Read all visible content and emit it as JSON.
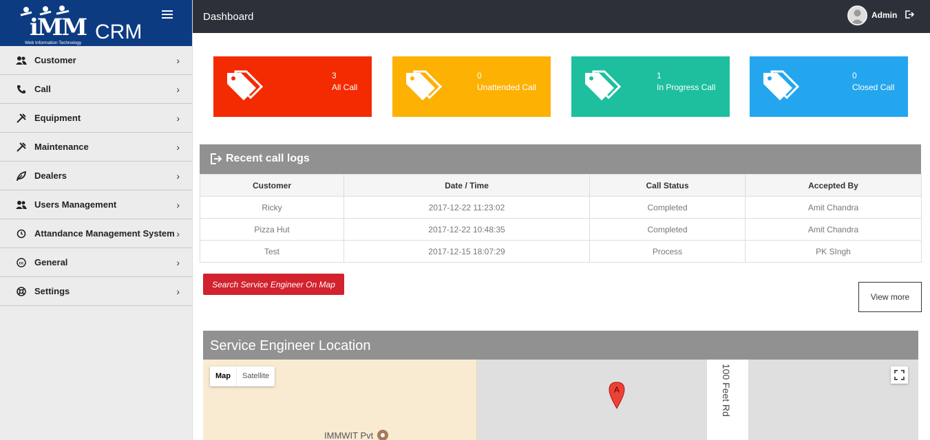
{
  "brand": {
    "logo_text": "iMM",
    "logo_sub": "Web Information Technology",
    "app_name": "CRM"
  },
  "sidebar": {
    "items": [
      {
        "label": "Customer",
        "icon": "users-icon"
      },
      {
        "label": "Call",
        "icon": "phone-icon"
      },
      {
        "label": "Equipment",
        "icon": "tools-icon"
      },
      {
        "label": "Maintenance",
        "icon": "tools-icon"
      },
      {
        "label": "Dealers",
        "icon": "leaf-icon"
      },
      {
        "label": "Users Management",
        "icon": "users-icon"
      },
      {
        "label": "Attandance Management System",
        "icon": "history-icon"
      },
      {
        "label": "General",
        "icon": "cc-icon"
      },
      {
        "label": "Settings",
        "icon": "lifebuoy-icon"
      }
    ],
    "chevron": "›"
  },
  "topbar": {
    "title": "Dashboard",
    "user": "Admin"
  },
  "cards": [
    {
      "count": "3",
      "label": "All Call",
      "color": "#f42a00"
    },
    {
      "count": "0",
      "label": "Unattended Call",
      "color": "#fdb103"
    },
    {
      "count": "1",
      "label": "In Progress Call",
      "color": "#1dbf9f"
    },
    {
      "count": "0",
      "label": "Closed Call",
      "color": "#24a6ee"
    }
  ],
  "recent_calls": {
    "title": "Recent call logs",
    "columns": [
      "Customer",
      "Date / Time",
      "Call Status",
      "Accepted By"
    ],
    "rows": [
      [
        "Ricky",
        "2017-12-22 11:23:02",
        "Completed",
        "Amit Chandra"
      ],
      [
        "Pizza Hut",
        "2017-12-22 10:48:35",
        "Completed",
        "Amit Chandra"
      ],
      [
        "Test",
        "2017-12-15 18:07:29",
        "Process",
        "PK SIngh"
      ]
    ]
  },
  "buttons": {
    "search_map": "Search Service Engineer On Map",
    "view_more": "View more"
  },
  "map": {
    "title": "Service Engineer Location",
    "map_tab": "Map",
    "satellite_tab": "Satellite",
    "marker_label": "A",
    "road_label": "100 Feet Rd",
    "place_label": "IMMWIT Pvt"
  }
}
